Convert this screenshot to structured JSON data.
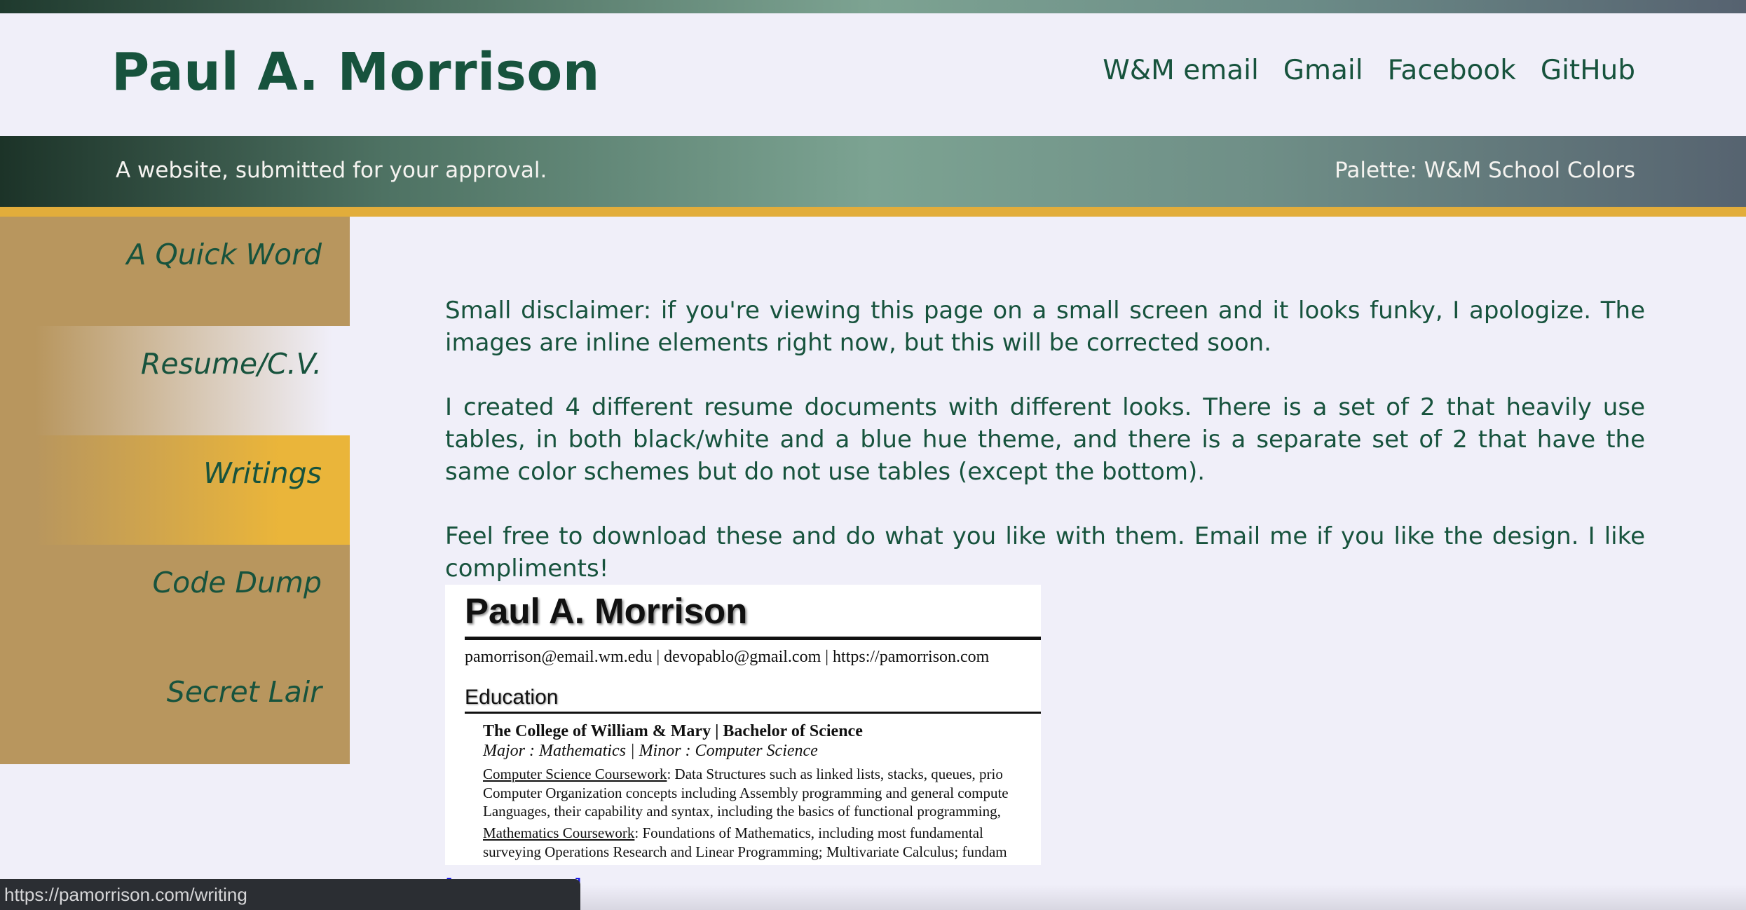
{
  "header": {
    "site_title": "Paul A. Morrison",
    "links": [
      "W&M email",
      "Gmail",
      "Facebook",
      "GitHub"
    ]
  },
  "banner": {
    "tagline": "A website, submitted for your approval.",
    "palette": "Palette: W&M School Colors"
  },
  "sidebar": {
    "items": [
      {
        "label": "A Quick Word",
        "state": "normal"
      },
      {
        "label": "Resume/C.V.",
        "state": "hover"
      },
      {
        "label": "Writings",
        "state": "active"
      },
      {
        "label": "Code Dump",
        "state": "normal"
      },
      {
        "label": "Secret Lair",
        "state": "normal"
      }
    ]
  },
  "content": {
    "paragraphs": [
      "Small disclaimer: if you're viewing this page on a small screen and it looks funky, I apologize. The images are inline elements right now, but this will be corrected soon.",
      "I created 4 different resume documents with different looks. There is a set of 2 that heavily use tables, in both black/white and a blue hue theme, and there is a separate set of 2 that have the same color schemes but do not use tables (except the bottom).",
      "Feel free to download these and do what you like with them. Email me if you like the design. I like compliments!"
    ],
    "resume_preview": {
      "name": "Paul A. Morrison",
      "contact": "pamorrison@email.wm.edu  |  devopablo@gmail.com  |  https://pamorrison.com",
      "section": "Education",
      "school": "The College of William & Mary   |   Bachelor of Science",
      "major": "Major : Mathematics   |   Minor : Computer Science",
      "cs_label": "Computer Science Coursework",
      "cs_line1": ": Data Structures such as linked lists, stacks, queues, prio",
      "cs_line2": "Computer Organization concepts including Assembly programming and general compute",
      "cs_line3": "Languages, their capability and syntax, including the basics of functional programming,",
      "math_label": "Mathematics Coursework",
      "math_line1": ": Foundations of Mathematics, including most fundamental",
      "math_line2": "surveying Operations Research and Linear Programming; Multivariate Calculus; fundam"
    },
    "partial_link_text": "[. . . . . . . . . ]"
  },
  "status_bar": {
    "url": "https://pamorrison.com/writing"
  },
  "colors": {
    "primary_green": "#17533d",
    "gold": "#e2ad3b",
    "sidebar_tan": "#b8965e",
    "background": "#f0eff9"
  }
}
